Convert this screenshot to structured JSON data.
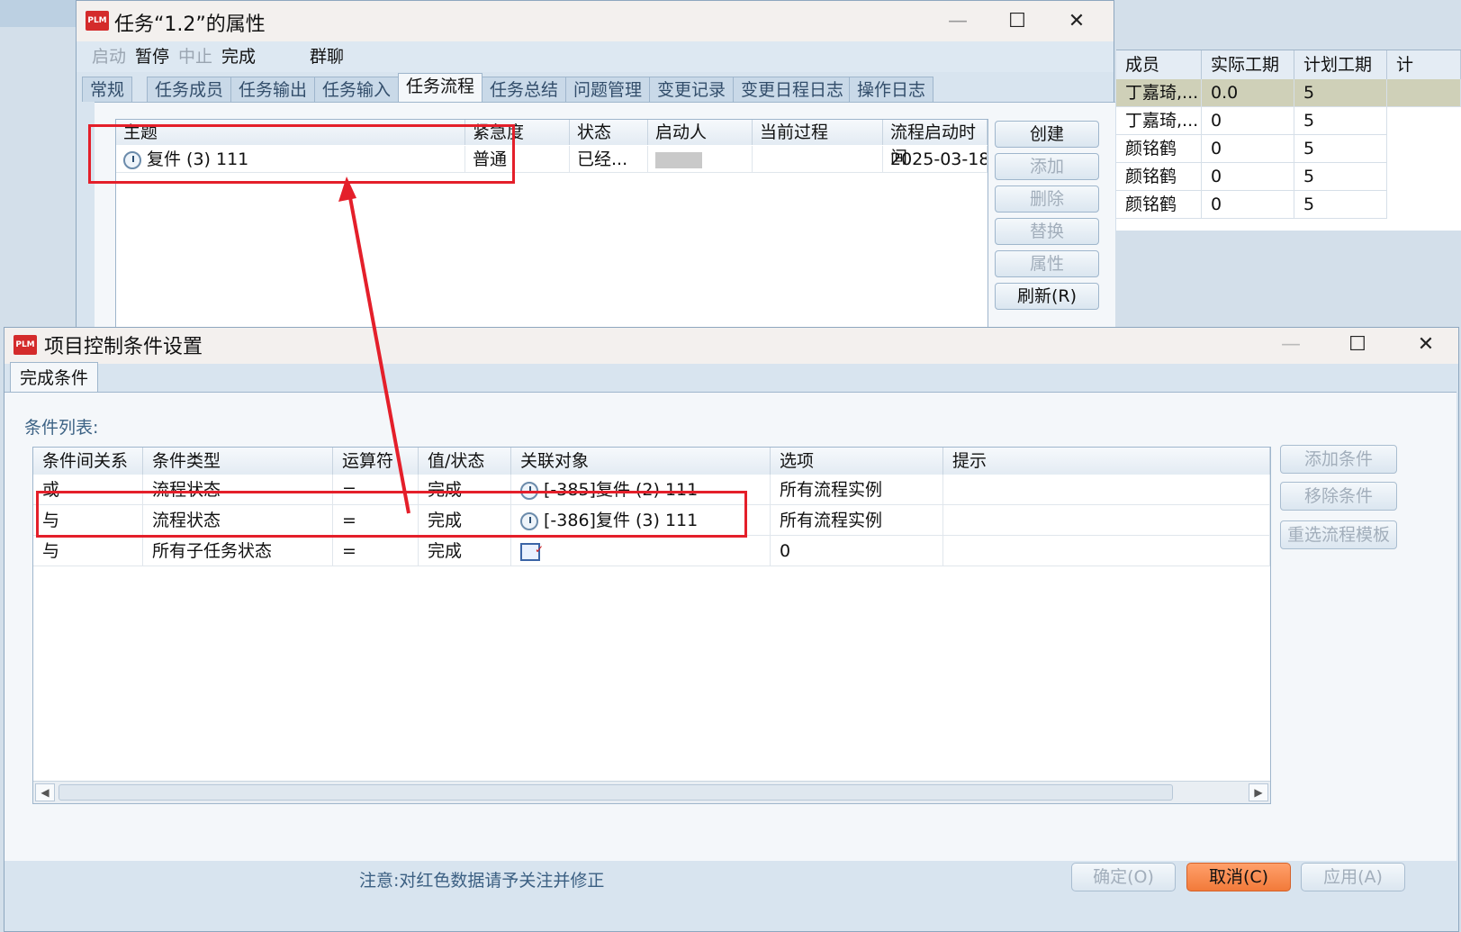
{
  "background_grid": {
    "headers": [
      "成员",
      "实际工期",
      "计划工期",
      "计"
    ],
    "rows": [
      {
        "member": "丁嘉琦,...",
        "actual": "0.0",
        "plan": "5"
      },
      {
        "member": "丁嘉琦,...",
        "actual": "0",
        "plan": "5"
      },
      {
        "member": "颜铭鹤",
        "actual": "0",
        "plan": "5"
      },
      {
        "member": "颜铭鹤",
        "actual": "0",
        "plan": "5"
      },
      {
        "member": "颜铭鹤",
        "actual": "0",
        "plan": "5"
      }
    ]
  },
  "task_window": {
    "logo": "PLM",
    "title": "任务“1.2”的属性",
    "toolbar": [
      "启动",
      "暂停",
      "中止",
      "完成",
      "群聊"
    ],
    "tabs": [
      "常规",
      "任务成员",
      "任务输出",
      "任务输入",
      "任务流程",
      "任务总结",
      "问题管理",
      "变更记录",
      "变更日程日志",
      "操作日志"
    ],
    "active_tab": "任务流程",
    "columns": [
      "主题",
      "紧急度",
      "状态",
      "启动人",
      "当前过程",
      "流程启动时间"
    ],
    "row": {
      "subject": "复件 (3) 111",
      "urgency": "普通",
      "status": "已经...",
      "starter": "",
      "process": "",
      "start_time": "2025-03-18"
    },
    "side_buttons": [
      "创建",
      "添加",
      "删除",
      "替换",
      "属性",
      "刷新(R)"
    ]
  },
  "condition_window": {
    "logo": "PLM",
    "title": "项目控制条件设置",
    "tab": "完成条件",
    "list_label": "条件列表:",
    "columns": [
      "条件间关系",
      "条件类型",
      "运算符",
      "值/状态",
      "关联对象",
      "选项",
      "提示"
    ],
    "rows": [
      {
        "relation": "或",
        "type": "流程状态",
        "op": "=",
        "value": "完成",
        "object": "[-385]复件 (2) 111",
        "option": "所有流程实例",
        "hint": ""
      },
      {
        "relation": "与",
        "type": "流程状态",
        "op": "=",
        "value": "完成",
        "object": "[-386]复件 (3) 111",
        "option": "所有流程实例",
        "hint": ""
      },
      {
        "relation": "与",
        "type": "所有子任务状态",
        "op": "=",
        "value": "完成",
        "object": "",
        "option": "0",
        "hint": ""
      }
    ],
    "side_buttons": [
      "添加条件",
      "移除条件",
      "重选流程模板"
    ],
    "notice": "注意:对红色数据请予关注并修正",
    "footer_buttons": [
      "确定(O)",
      "取消(C)",
      "应用(A)"
    ]
  },
  "colors": {
    "annotation": "#e41f2a",
    "cancel_button": "#f5854a"
  }
}
